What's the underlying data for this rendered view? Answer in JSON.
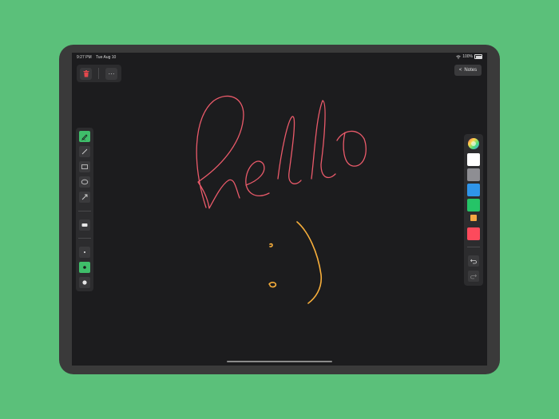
{
  "status": {
    "time": "9:27 PM",
    "date": "Tue Aug 10",
    "battery": "100%"
  },
  "toolbar": {
    "notes_label": "Notes",
    "more_label": "···"
  },
  "tools": [
    {
      "name": "pen-tool",
      "icon": "pen-icon",
      "active": true
    },
    {
      "name": "line-tool",
      "icon": "line-icon",
      "active": false
    },
    {
      "name": "rectangle-tool",
      "icon": "rectangle-icon",
      "active": false
    },
    {
      "name": "ellipse-tool",
      "icon": "ellipse-icon",
      "active": false
    },
    {
      "name": "arrow-tool",
      "icon": "arrow-icon",
      "active": false
    },
    {
      "name": "eraser-tool",
      "icon": "eraser-icon",
      "active": false
    },
    {
      "name": "size-small",
      "icon": "dot-small-icon",
      "active": false
    },
    {
      "name": "size-medium",
      "icon": "dot-medium-icon",
      "active": true
    },
    {
      "name": "size-large",
      "icon": "dot-large-icon",
      "active": false
    }
  ],
  "palette": [
    "#ffffff",
    "#8e8e93",
    "#2f95ea",
    "#25c467",
    "#f5a742",
    "#fd4a5c"
  ],
  "colors": {
    "background": "#5bc07a",
    "accent": "#3fbe6a",
    "stroke_red": "#ea5a6a",
    "stroke_orange": "#f7ae3b"
  }
}
